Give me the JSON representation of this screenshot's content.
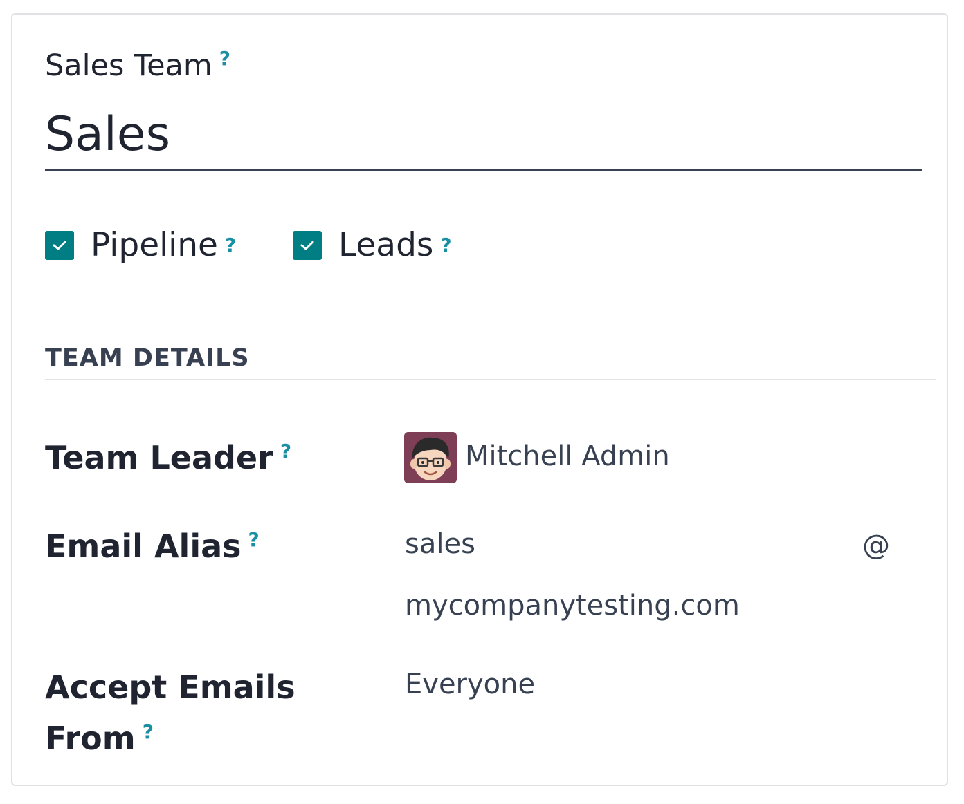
{
  "form": {
    "title_label": "Sales Team",
    "title_value": "Sales",
    "help_mark": "?",
    "checkboxes": [
      {
        "label": "Pipeline",
        "checked": true
      },
      {
        "label": "Leads",
        "checked": true
      }
    ],
    "section_title": "TEAM DETAILS",
    "fields": {
      "team_leader": {
        "label": "Team Leader",
        "value": "Mitchell Admin",
        "avatar_icon": "user-avatar-icon"
      },
      "email_alias": {
        "label": "Email Alias",
        "alias": "sales",
        "at": "@",
        "domain": "mycompanytesting.com"
      },
      "accept_emails": {
        "label_line1": "Accept Emails",
        "label_line2": "From",
        "value": "Everyone"
      }
    }
  },
  "colors": {
    "accent": "#017e84",
    "help": "#1a8fa3",
    "text": "#1f2430",
    "muted": "#374151"
  }
}
